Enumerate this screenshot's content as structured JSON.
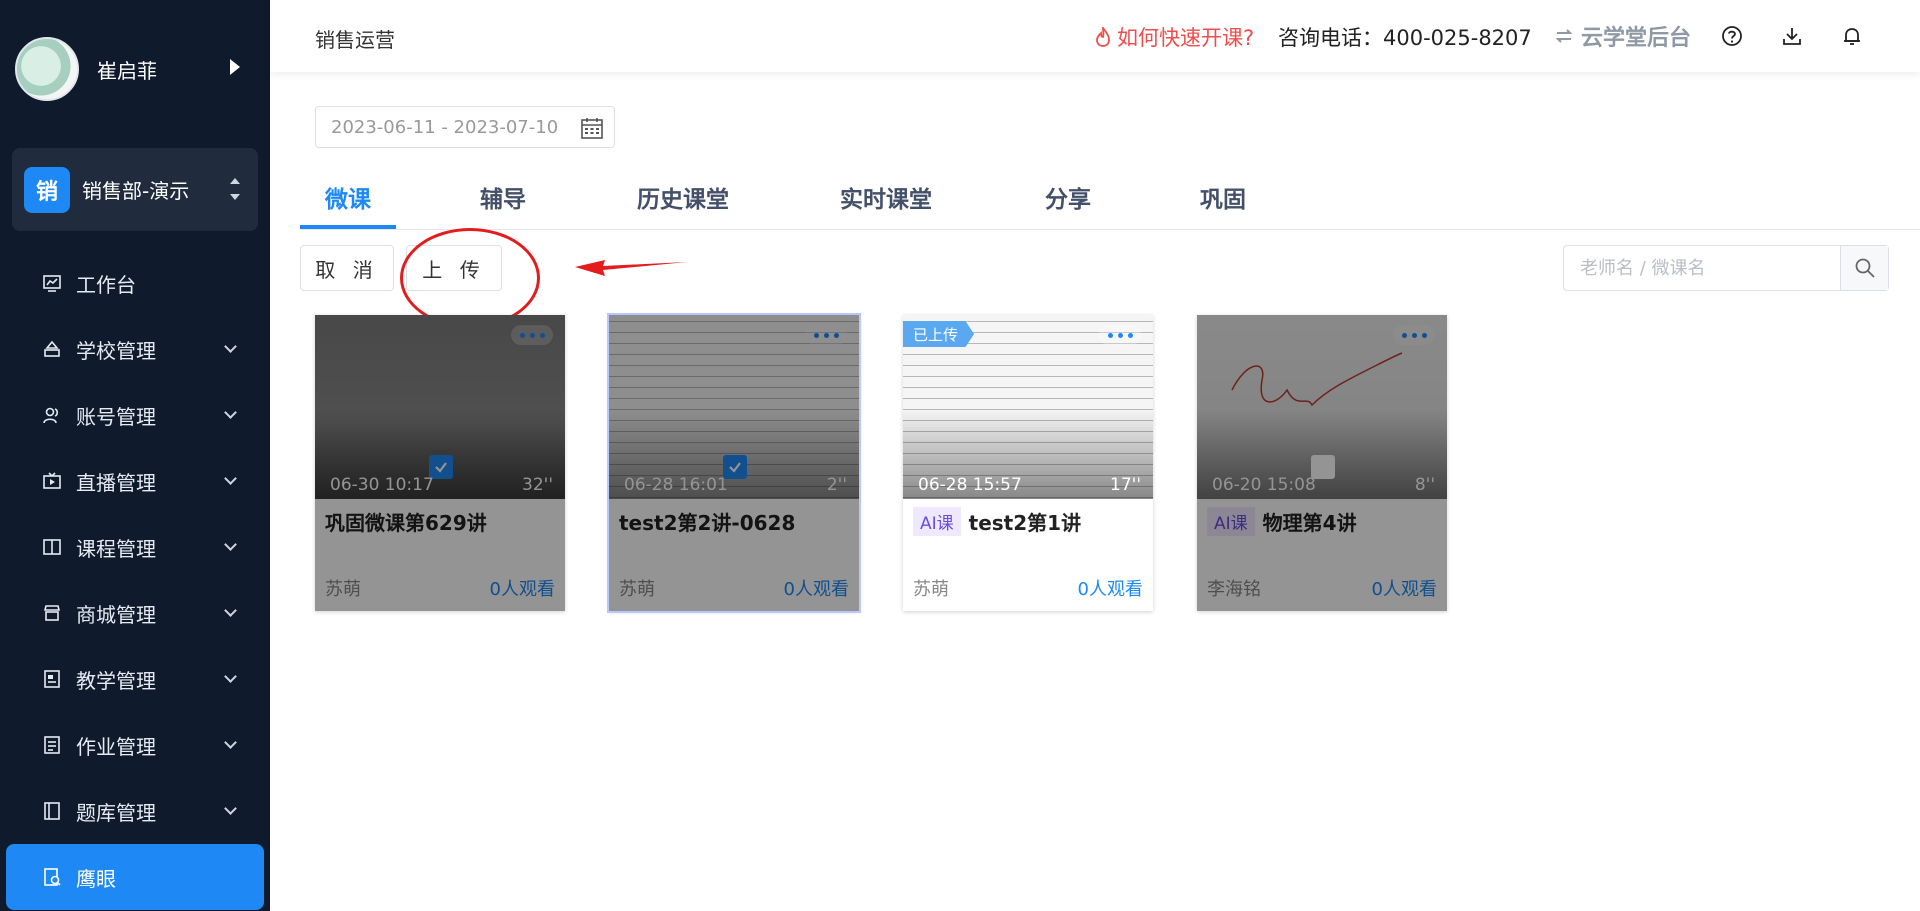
{
  "sidebar": {
    "user_name": "崔启菲",
    "dept_badge": "销",
    "dept_name": "销售部-演示",
    "menu": [
      {
        "label": "工作台",
        "icon": "chart-icon"
      },
      {
        "label": "学校管理",
        "icon": "school-icon"
      },
      {
        "label": "账号管理",
        "icon": "users-icon"
      },
      {
        "label": "直播管理",
        "icon": "live-icon"
      },
      {
        "label": "课程管理",
        "icon": "book-icon"
      },
      {
        "label": "商城管理",
        "icon": "shop-icon"
      },
      {
        "label": "教学管理",
        "icon": "teach-icon"
      },
      {
        "label": "作业管理",
        "icon": "homework-icon"
      },
      {
        "label": "题库管理",
        "icon": "question-bank-icon"
      },
      {
        "label": "鹰眼",
        "icon": "eagle-eye-icon"
      }
    ]
  },
  "header": {
    "breadcrumb": "销售运营",
    "quick_start": "如何快速开课?",
    "phone": "咨询电话：400-025-8207",
    "backend": "云学堂后台"
  },
  "filter": {
    "date_range": "2023-06-11 - 2023-07-10"
  },
  "tabs": [
    "微课",
    "辅导",
    "历史课堂",
    "实时课堂",
    "分享",
    "巩固"
  ],
  "actions": {
    "cancel": "取 消",
    "upload": "上 传"
  },
  "search": {
    "placeholder": "老师名 / 微课名"
  },
  "cards": [
    {
      "date": "06-30 10:17",
      "duration": "32''",
      "title": "巩固微课第629讲",
      "author": "苏萌",
      "views": "0人观看",
      "ai_tag": "",
      "uploaded_tag": "",
      "checked": true,
      "dimmed": true
    },
    {
      "date": "06-28 16:01",
      "duration": "2''",
      "title": "test2第2讲-0628",
      "author": "苏萌",
      "views": "0人观看",
      "ai_tag": "",
      "uploaded_tag": "",
      "checked": true,
      "dimmed": true
    },
    {
      "date": "06-28 15:57",
      "duration": "17''",
      "title": "test2第1讲",
      "author": "苏萌",
      "views": "0人观看",
      "ai_tag": "AI课",
      "uploaded_tag": "已上传",
      "checked": false,
      "dimmed": false
    },
    {
      "date": "06-20 15:08",
      "duration": "8''",
      "title": "物理第4讲",
      "author": "李海铭",
      "views": "0人观看",
      "ai_tag": "AI课",
      "uploaded_tag": "",
      "checked": false,
      "dimmed": true
    }
  ],
  "colors": {
    "sidebar_bg": "#0f1b2d",
    "accent": "#1e88f5",
    "annotation_red": "#e31d1d"
  }
}
